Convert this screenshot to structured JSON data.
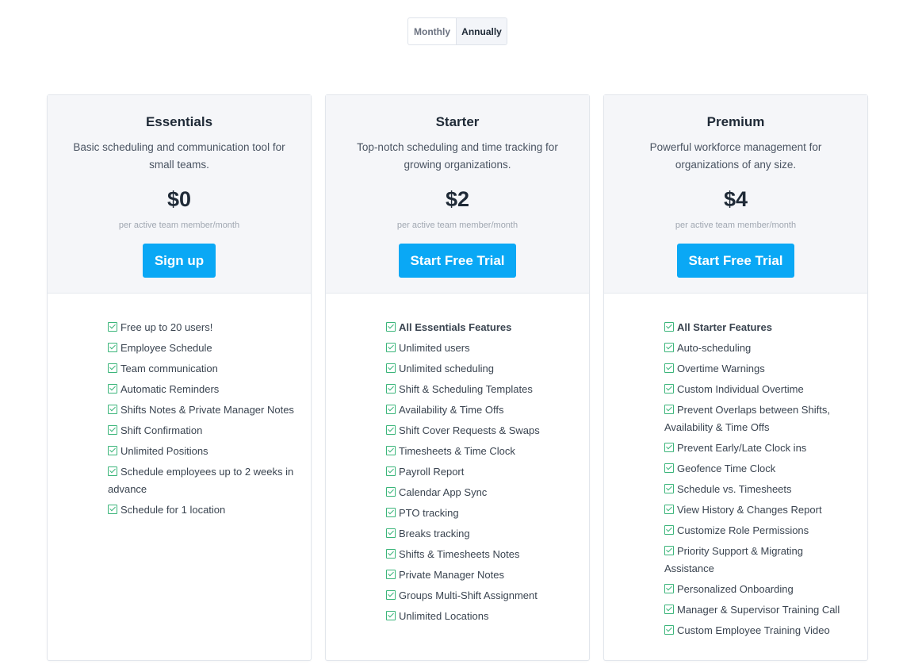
{
  "billing_toggle": {
    "monthly": "Monthly",
    "annually": "Annually"
  },
  "plans": [
    {
      "name": "Essentials",
      "description": "Basic scheduling and communication tool for small teams.",
      "price": "$0",
      "unit": "per active team member/month",
      "cta": "Sign up",
      "features": [
        "Free up to 20 users!",
        "Employee Schedule",
        "Team communication",
        "Automatic Reminders",
        "Shifts Notes & Private Manager Notes",
        "Shift Confirmation",
        "Unlimited Positions",
        "Schedule employees up to 2 weeks in advance",
        "Schedule for 1 location"
      ]
    },
    {
      "name": "Starter",
      "description": "Top-notch scheduling and time tracking for growing organizations.",
      "price": "$2",
      "unit": "per active team member/month",
      "cta": "Start Free Trial",
      "features": [
        "All Essentials Features",
        "Unlimited users",
        "Unlimited scheduling",
        "Shift & Scheduling Templates",
        "Availability & Time Offs",
        "Shift Cover Requests & Swaps",
        "Timesheets & Time Clock",
        "Payroll Report",
        "Calendar App Sync",
        "PTO tracking",
        "Breaks tracking",
        "Shifts & Timesheets Notes",
        "Private Manager Notes",
        "Groups Multi-Shift Assignment",
        "Unlimited Locations"
      ]
    },
    {
      "name": "Premium",
      "description": "Powerful workforce management for organizations of any size.",
      "price": "$4",
      "unit": "per active team member/month",
      "cta": "Start Free Trial",
      "features": [
        "All Starter Features",
        "Auto-scheduling",
        "Overtime Warnings",
        "Custom Individual Overtime",
        "Prevent Overlaps between Shifts, Availability & Time Offs",
        "Prevent Early/Late Clock ins",
        "Geofence Time Clock",
        "Schedule vs. Timesheets",
        "View History & Changes Report",
        "Customize Role Permissions",
        "Priority Support & Migrating Assistance",
        "Personalized Onboarding",
        "Manager & Supervisor Training Call",
        "Custom Employee Training Video"
      ]
    }
  ],
  "colors": {
    "accent": "#0aa8f5",
    "check": "#3bb57a",
    "header_bg": "#f5f6f9"
  }
}
